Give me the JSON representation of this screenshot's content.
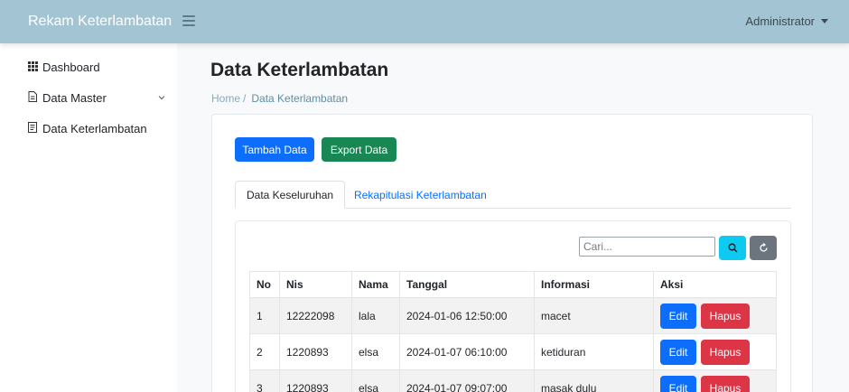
{
  "header": {
    "brand": "Rekam Keterlambatan",
    "user": "Administrator"
  },
  "sidebar": {
    "items": [
      {
        "label": "Dashboard",
        "icon": "grid-icon"
      },
      {
        "label": "Data Master",
        "icon": "document-icon"
      },
      {
        "label": "Data Keterlambatan",
        "icon": "file-icon"
      }
    ]
  },
  "page": {
    "title": "Data Keterlambatan",
    "breadcrumb": {
      "home": "Home",
      "separator": "/",
      "current": "Data Keterlambatan"
    }
  },
  "actions": {
    "add": "Tambah Data",
    "export": "Export Data"
  },
  "tabs": [
    {
      "label": "Data Keseluruhan"
    },
    {
      "label": "Rekapitulasi Keterlambatan"
    }
  ],
  "search": {
    "placeholder": "Cari..."
  },
  "table": {
    "headers": [
      "No",
      "Nis",
      "Nama",
      "Tanggal",
      "Informasi",
      "Aksi"
    ],
    "rows": [
      {
        "no": "1",
        "nis": "12222098",
        "nama": "lala",
        "tanggal": "2024-01-06 12:50:00",
        "informasi": "macet"
      },
      {
        "no": "2",
        "nis": "1220893",
        "nama": "elsa",
        "tanggal": "2024-01-07 06:10:00",
        "informasi": "ketiduran"
      },
      {
        "no": "3",
        "nis": "1220893",
        "nama": "elsa",
        "tanggal": "2024-01-07 09:07:00",
        "informasi": "masak dulu"
      }
    ],
    "edit_label": "Edit",
    "delete_label": "Hapus"
  },
  "colors": {
    "topbar": "#a3c4d3",
    "primary": "#0d6efd",
    "success": "#198754",
    "danger": "#dc3545",
    "info": "#0dcaf0",
    "secondary": "#6c757d"
  }
}
